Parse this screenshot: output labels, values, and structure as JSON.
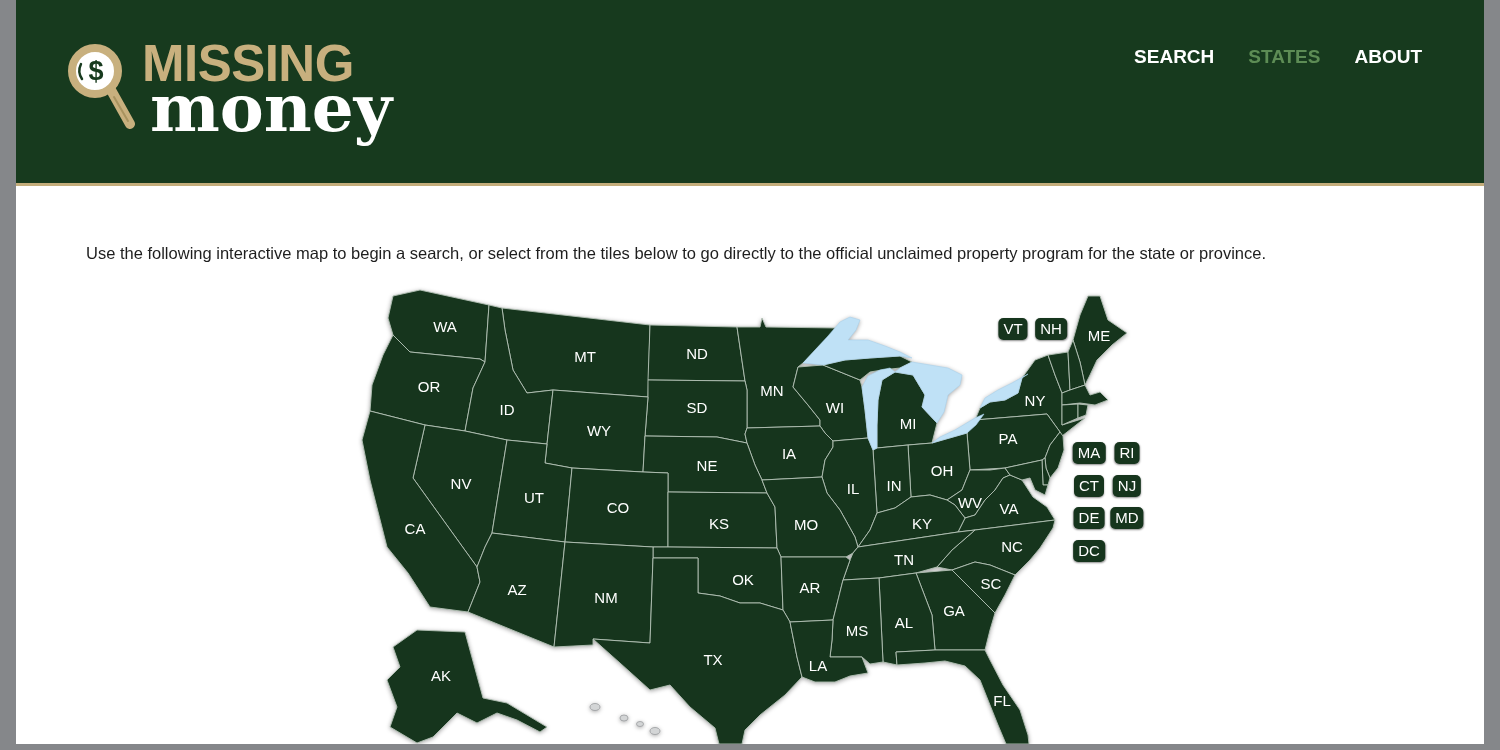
{
  "header": {
    "logo": {
      "symbol": "$",
      "line_1": "MISSING",
      "line_2": "money"
    },
    "nav": [
      {
        "label": "SEARCH",
        "selected": false
      },
      {
        "label": "STATES",
        "selected": true
      },
      {
        "label": "ABOUT",
        "selected": false
      }
    ]
  },
  "intro": "Use the following interactive map to begin a search, or select from the tiles below to go directly to the official unclaimed property program for the state or province.",
  "map": {
    "states": [
      {
        "label": "WA"
      },
      {
        "label": "MT"
      },
      {
        "label": "ND"
      },
      {
        "label": "MN"
      },
      {
        "label": "ME"
      },
      {
        "label": "OR"
      },
      {
        "label": "ID"
      },
      {
        "label": "SD"
      },
      {
        "label": "WI"
      },
      {
        "label": "MI"
      },
      {
        "label": "NY"
      },
      {
        "label": "WY"
      },
      {
        "label": "PA"
      },
      {
        "label": "IA"
      },
      {
        "label": "NE"
      },
      {
        "label": "NV"
      },
      {
        "label": "OH"
      },
      {
        "label": "IN"
      },
      {
        "label": "UT"
      },
      {
        "label": "IL"
      },
      {
        "label": "CO"
      },
      {
        "label": "WV"
      },
      {
        "label": "VA"
      },
      {
        "label": "CA"
      },
      {
        "label": "KS"
      },
      {
        "label": "MO"
      },
      {
        "label": "KY"
      },
      {
        "label": "NC"
      },
      {
        "label": "TN"
      },
      {
        "label": "OK"
      },
      {
        "label": "SC"
      },
      {
        "label": "AZ"
      },
      {
        "label": "NM"
      },
      {
        "label": "AR"
      },
      {
        "label": "GA"
      },
      {
        "label": "AL"
      },
      {
        "label": "MS"
      },
      {
        "label": "TX"
      },
      {
        "label": "LA"
      },
      {
        "label": "AK"
      },
      {
        "label": "FL"
      }
    ],
    "tiles": [
      {
        "label": "VT"
      },
      {
        "label": "NH"
      },
      {
        "label": "MA"
      },
      {
        "label": "RI"
      },
      {
        "label": "CT"
      },
      {
        "label": "NJ"
      },
      {
        "label": "DE"
      },
      {
        "label": "MD"
      },
      {
        "label": "DC"
      }
    ]
  }
}
